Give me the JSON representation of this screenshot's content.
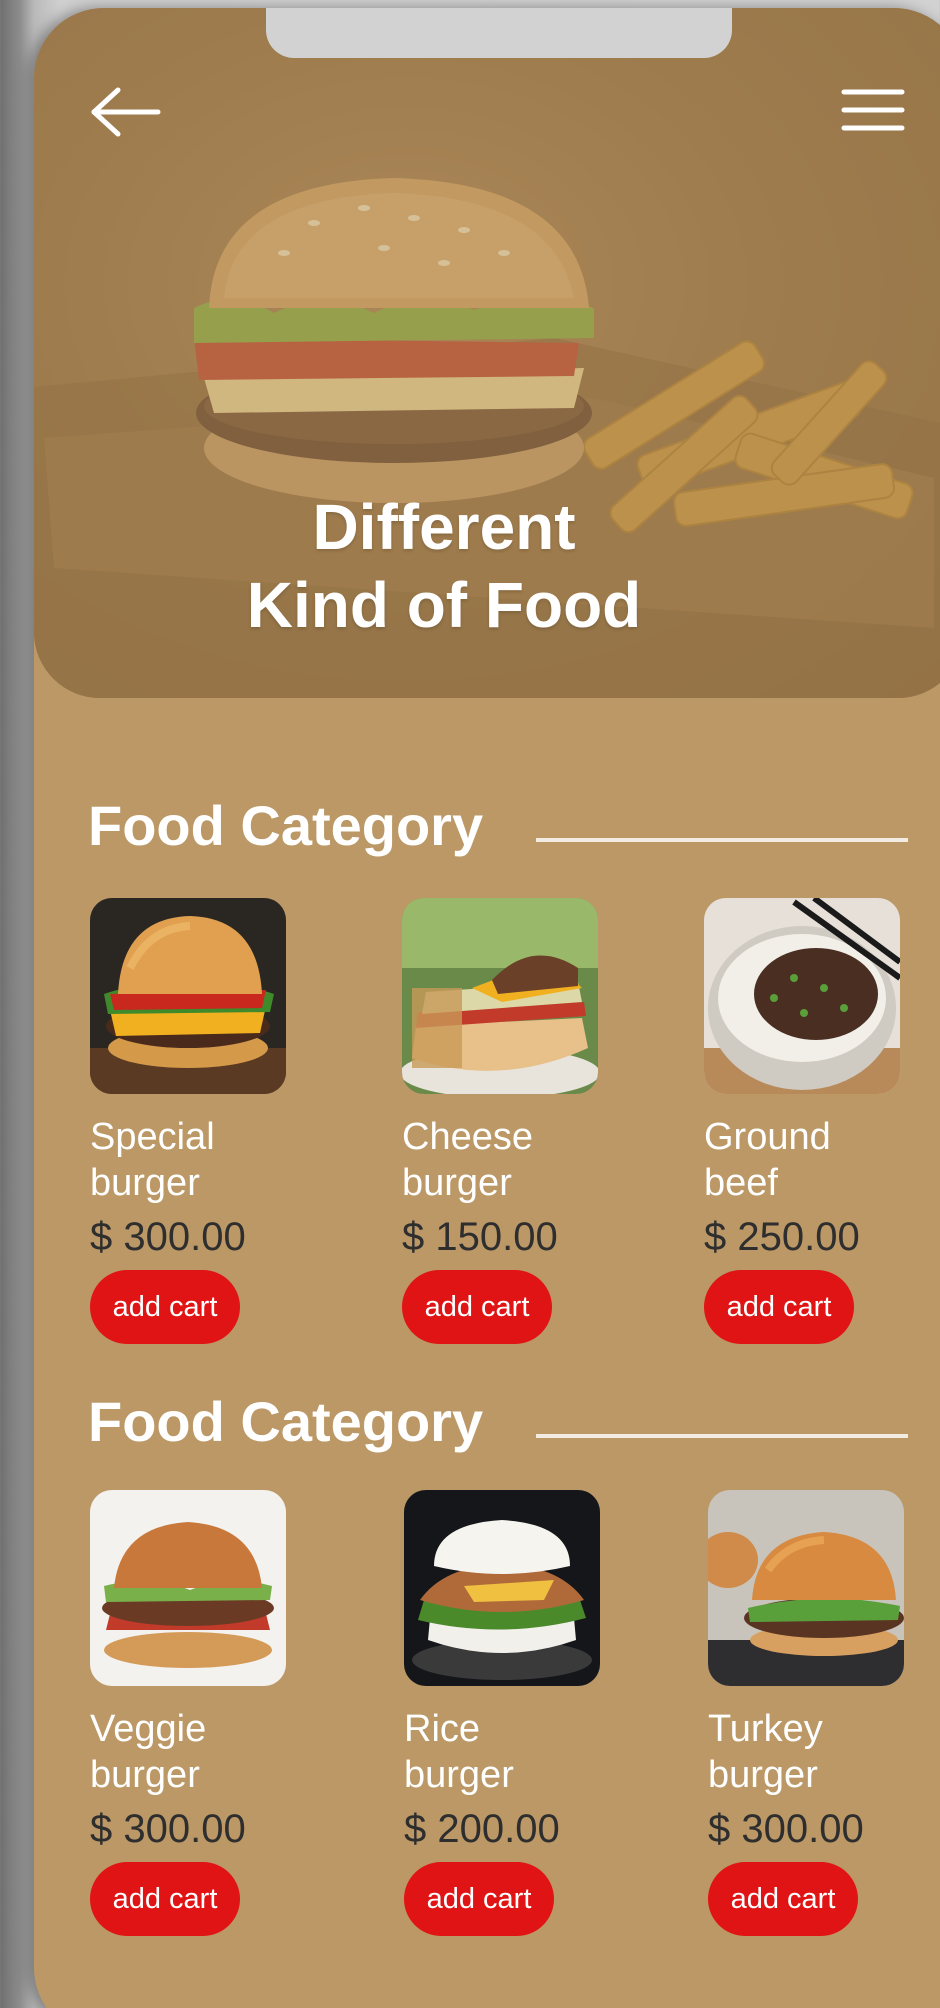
{
  "header": {
    "back_icon": "arrow-left-icon",
    "menu_icon": "hamburger-menu-icon",
    "title_line1": "Different",
    "title_line2": "Kind of Food"
  },
  "sections": [
    {
      "title": "Food Category",
      "items": [
        {
          "name_line1": "Special",
          "name_line2": "burger",
          "price": "$ 300.00",
          "button": "add cart"
        },
        {
          "name_line1": "Cheese",
          "name_line2": "burger",
          "price": "$ 150.00",
          "button": "add cart"
        },
        {
          "name_line1": "Ground",
          "name_line2": "beef",
          "price": "$ 250.00",
          "button": "add cart"
        }
      ]
    },
    {
      "title": "Food Category",
      "items": [
        {
          "name_line1": "Veggie",
          "name_line2": "burger",
          "price": "$ 300.00",
          "button": "add cart"
        },
        {
          "name_line1": "Rice",
          "name_line2": "burger",
          "price": "$ 200.00",
          "button": "add cart"
        },
        {
          "name_line1": "Turkey",
          "name_line2": "burger",
          "price": "$ 300.00",
          "button": "add cart"
        }
      ]
    }
  ],
  "colors": {
    "background": "#bb9866",
    "button": "#e01414",
    "price_text": "#2e2e2e"
  }
}
